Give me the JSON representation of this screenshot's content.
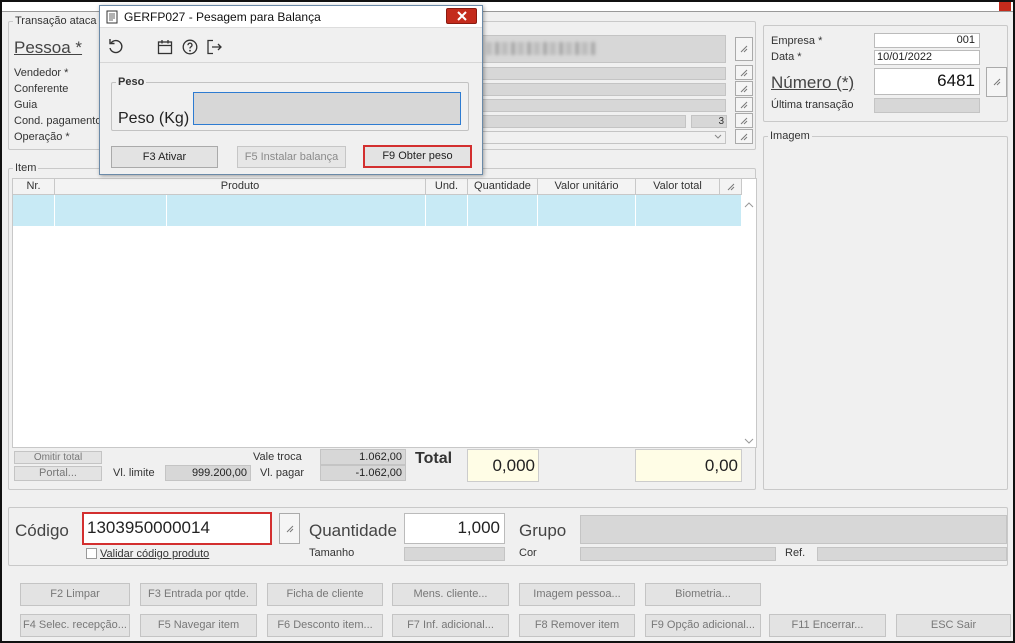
{
  "dialog": {
    "title": "GERFP027 - Pesagem para Balança",
    "group_label": "Peso",
    "weight_label": "Peso (Kg)",
    "buttons": {
      "activate": "F3 Ativar",
      "install": "F5 Instalar balança",
      "get_weight": "F9 Obter peso"
    }
  },
  "header": {
    "group_label": "Transação ataca",
    "person_label": "Pessoa *",
    "labels": [
      "Vendedor *",
      "Conferente",
      "Guia",
      "Cond. pagamento",
      "Operação *"
    ],
    "cond_pagamento_value": "3"
  },
  "right_panel": {
    "empresa_label": "Empresa *",
    "empresa_value": "001",
    "data_label": "Data *",
    "data_value": "10/01/2022",
    "numero_label": "Número (*)",
    "numero_value": "6481",
    "ultima_label": "Última transação",
    "imagem_label": "Imagem"
  },
  "items": {
    "group_label": "Item",
    "columns": [
      "Nr.",
      "Produto",
      "Und.",
      "Quantidade",
      "Valor unitário",
      "Valor total"
    ]
  },
  "totals": {
    "omitir_total": "Omitir total",
    "portal": "Portal...",
    "vl_limite_label": "Vl. limite",
    "vl_limite_value": "999.200,00",
    "vale_troca_label": "Vale troca",
    "vale_troca_value": "1.062,00",
    "vl_pagar_label": "Vl. pagar",
    "vl_pagar_value": "-1.062,00",
    "total_label": "Total",
    "total_qty": "0,000",
    "total_value": "0,00"
  },
  "entry": {
    "codigo_label": "Código",
    "codigo_value": "1303950000014",
    "validar_label": "Validar código produto",
    "quantidade_label": "Quantidade",
    "quantidade_value": "1,000",
    "tamanho_label": "Tamanho",
    "grupo_label": "Grupo",
    "cor_label": "Cor",
    "ref_label": "Ref."
  },
  "footer_row1": [
    "F2 Limpar",
    "F3 Entrada por qtde.",
    "Ficha de cliente",
    "Mens. cliente...",
    "Imagem pessoa...",
    "Biometria..."
  ],
  "footer_row2": [
    "F4 Selec. recepção...",
    "F5 Navegar item",
    "F6 Desconto item...",
    "F7 Inf. adicional...",
    "F8 Remover item",
    "F9 Opção adicional...",
    "F11 Encerrar...",
    "ESC Sair"
  ],
  "colors": {
    "highlight": "#d32f2f",
    "row_selected": "#c8eaf5",
    "total_bg": "#fffde6"
  }
}
